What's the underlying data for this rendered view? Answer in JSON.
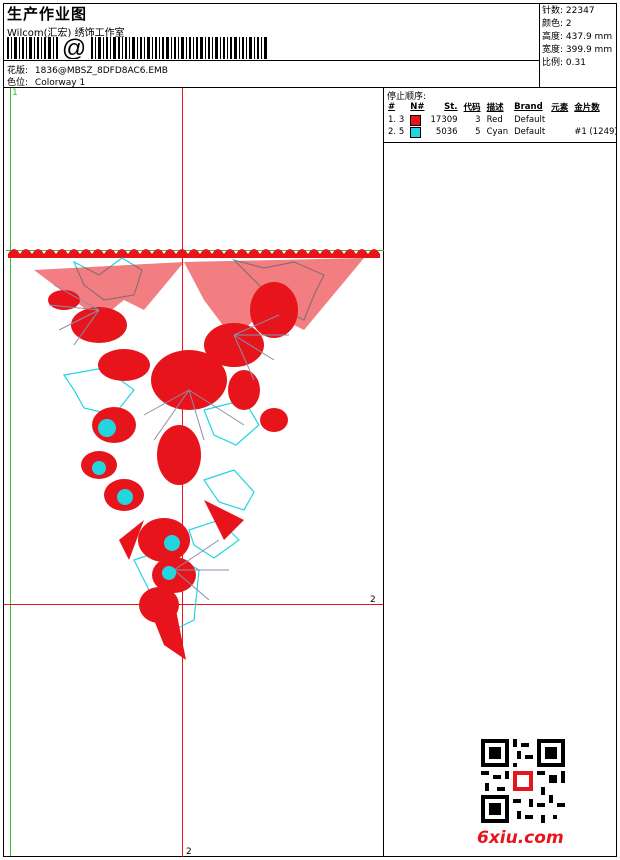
{
  "header": {
    "title": "生产作业图",
    "studio": "Wilcom(汇宏) 绣饰工作室",
    "barcode_symbol": "@",
    "pattern_label": "花版:",
    "pattern_value": "1836@MBSZ_8DFD8AC6.EMB",
    "colorway_label": "色位:",
    "colorway_value": "Colorway 1"
  },
  "stats": {
    "stitches_label": "针数:",
    "stitches_value": "22347",
    "colors_label": "颜色:",
    "colors_value": "2",
    "height_label": "高度:",
    "height_value": "437.9 mm",
    "width_label": "宽度:",
    "width_value": "399.9 mm",
    "scale_label": "比例:",
    "scale_value": "0.31"
  },
  "sequence": {
    "title": "停止顺序:",
    "headers": [
      "#",
      "N#",
      "St.",
      "代码",
      "描述",
      "Brand",
      "元素",
      "金片数"
    ],
    "rows": [
      {
        "idx": "1.",
        "n": "3",
        "color": "#e8141c",
        "st": "17309",
        "code": "3",
        "desc": "Red",
        "brand": "Default",
        "element": "",
        "sequins": ""
      },
      {
        "idx": "2.",
        "n": "5",
        "color": "#22d6e0",
        "st": "5036",
        "code": "5",
        "desc": "Cyan",
        "brand": "Default",
        "element": "",
        "sequins": "#1 (1249)"
      }
    ]
  },
  "markers": {
    "top_left": "1",
    "right": "2",
    "bottom": "2"
  },
  "watermark": {
    "logo": "6xiu.com"
  }
}
